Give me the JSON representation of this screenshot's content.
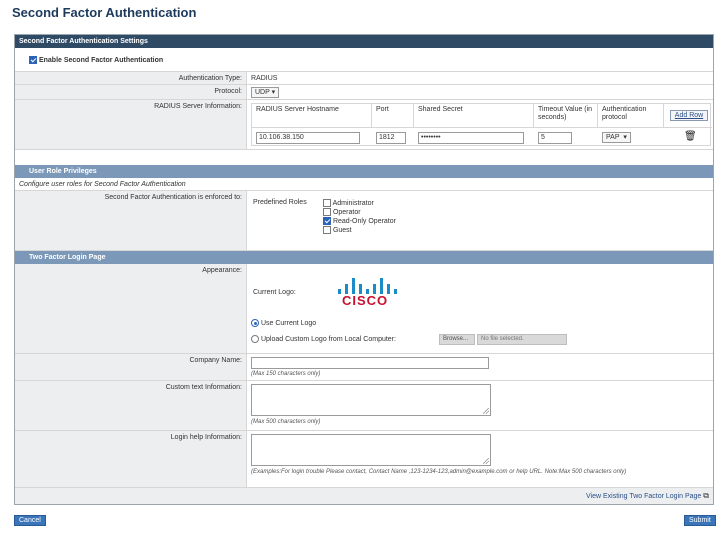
{
  "page": {
    "title": "Second Factor Authentication"
  },
  "settings": {
    "header": "Second Factor Authentication Settings",
    "enable_label": "Enable Second Factor Authentication",
    "enable_checked": true,
    "auth_type_label": "Authentication Type:",
    "auth_type_value": "RADIUS",
    "protocol_label": "Protocol:",
    "protocol_value": "UDP",
    "radius_label": "RADIUS Server Information:",
    "table": {
      "headers": {
        "hostname": "RADIUS Server Hostname",
        "port": "Port",
        "secret": "Shared Secret",
        "timeout": "Timeout Value (in seconds)",
        "auth_protocol": "Authentication protocol"
      },
      "add_row": "Add Row",
      "row": {
        "hostname": "10.106.38.150",
        "port": "1812",
        "secret": "••••••••",
        "timeout": "5",
        "auth_protocol": "PAP"
      }
    }
  },
  "roles": {
    "header": "User Role Privileges",
    "description": "Configure user roles for Second Factor Authentication",
    "enforced_label": "Second Factor Authentication is enforced to:",
    "predefined_label": "Predefined Roles",
    "items": [
      {
        "label": "Administrator",
        "checked": false
      },
      {
        "label": "Operator",
        "checked": false
      },
      {
        "label": "Read-Only Operator",
        "checked": true
      },
      {
        "label": "Guest",
        "checked": false
      }
    ]
  },
  "login": {
    "header": "Two Factor Login Page",
    "appearance_label": "Appearance:",
    "current_logo_label": "Current Logo:",
    "logo_text": "CISCO",
    "use_current": "Use Current Logo",
    "upload_custom": "Upload Custom Logo from Local Computer:",
    "browse": "Browse...",
    "no_file": "No file selected.",
    "company_label": "Company Name:",
    "company_hint": "(Max 150 characters only)",
    "custom_label": "Custom text Information:",
    "custom_hint": "(Max 500 characters only)",
    "help_label": "Login help Information:",
    "help_hint": "(Examples:For login trouble Please contact, Contact Name ,123-1234-123,admin@example.com or help URL. Note:Max 500 characters only)",
    "view_link": "View Existing Two Factor Login Page"
  },
  "footer": {
    "cancel": "Cancel",
    "submit": "Submit"
  },
  "colors": {
    "section_dark": "#2f4a64",
    "section_light": "#7b98b8",
    "cisco_red": "#c8102e",
    "cisco_blue": "#1a8cc8"
  }
}
